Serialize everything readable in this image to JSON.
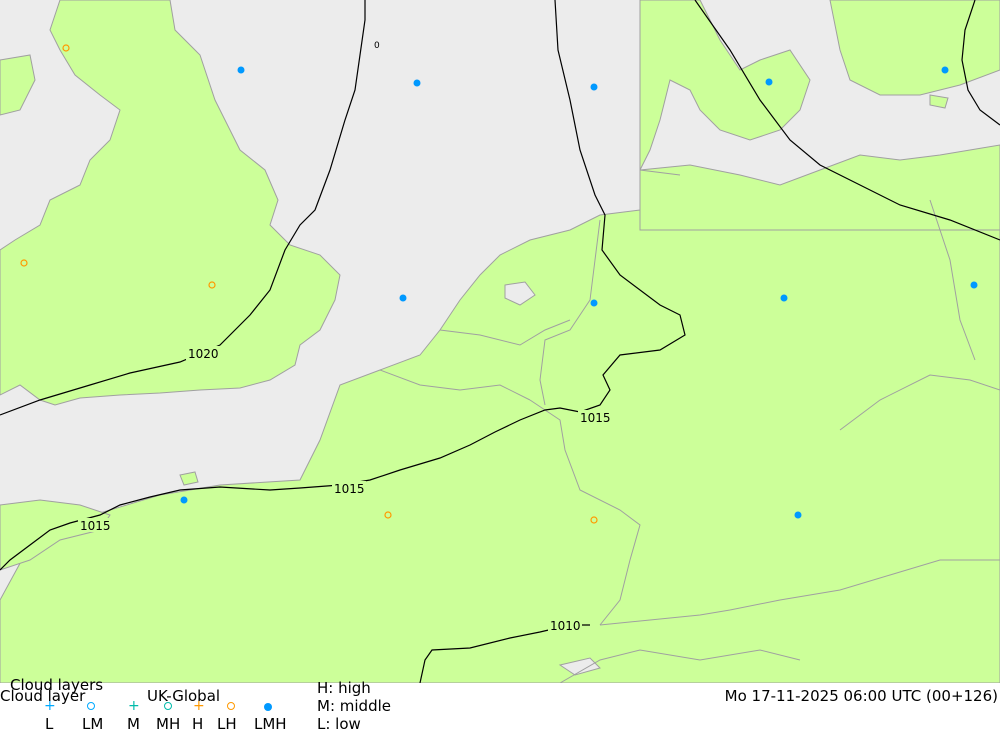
{
  "map": {
    "colors": {
      "sea": "#ececec",
      "land": "#ccff99",
      "coast": "#a0a0a0",
      "isobar": "#000000",
      "high_cloud": "#00aaff",
      "low_cloud_marker": "#ff9900",
      "lmh_dot": "#0099ff"
    },
    "isobars": [
      {
        "label": "1020"
      },
      {
        "label": "1015"
      },
      {
        "label": "1015"
      },
      {
        "label": "1015"
      },
      {
        "label": "1010"
      }
    ]
  },
  "legend": {
    "title_overlay": "Cloud layers",
    "title": "Cloud layer",
    "model": "UK-Global",
    "symbols": [
      {
        "code": "L",
        "icon": "plus",
        "color": "#00aaff"
      },
      {
        "code": "LM",
        "icon": "circle",
        "color": "#00aaff"
      },
      {
        "code": "M",
        "icon": "plus",
        "color": "#00bbaa"
      },
      {
        "code": "MH",
        "icon": "circle",
        "color": "#00bbaa"
      },
      {
        "code": "H",
        "icon": "plus",
        "color": "#ff9900"
      },
      {
        "code": "LH",
        "icon": "circle",
        "color": "#ff9900"
      },
      {
        "code": "LMH",
        "icon": "dot",
        "color": "#0099ff"
      }
    ],
    "key": {
      "high": "H: high",
      "middle": "M: middle",
      "low": "L: low"
    },
    "datetime": "Mo 17-11-2025 06:00 UTC (00+126)"
  }
}
